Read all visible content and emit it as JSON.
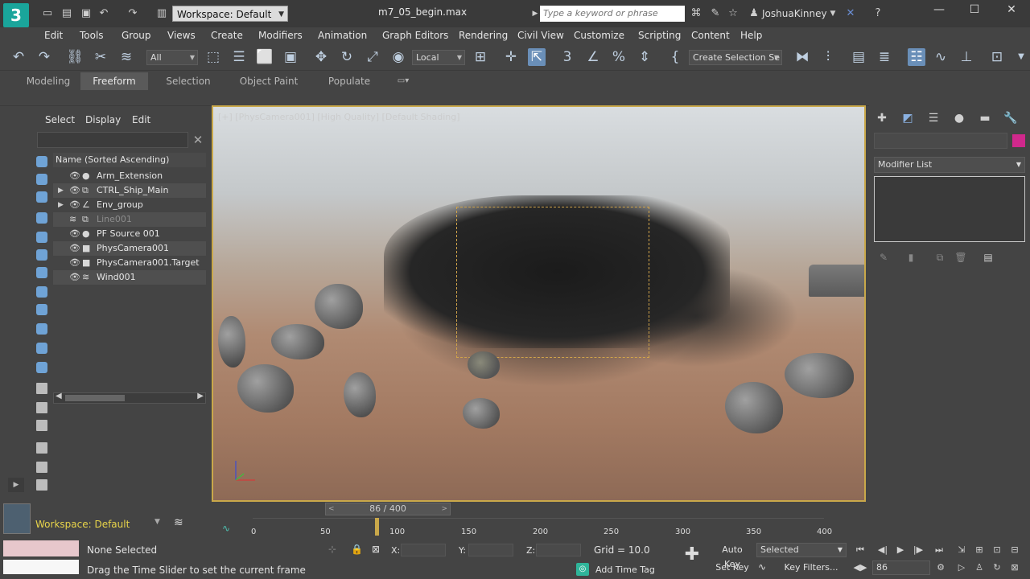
{
  "app": {
    "workspace": "Workspace: Default",
    "filename": "m7_05_begin.max",
    "search_placeholder": "Type a keyword or phrase",
    "username": "JoshuaKinney"
  },
  "menu": [
    "Edit",
    "Tools",
    "Group",
    "Views",
    "Create",
    "Modifiers",
    "Animation",
    "Graph Editors",
    "Rendering",
    "Civil View",
    "Customize",
    "Scripting",
    "Content",
    "Help"
  ],
  "toolbar": {
    "filter": "All",
    "coord_system": "Local",
    "selection_set": "Create Selection Se"
  },
  "ribbon_tabs": [
    "Modeling",
    "Freeform",
    "Selection",
    "Object Paint",
    "Populate"
  ],
  "explorer": {
    "menus": [
      "Select",
      "Display",
      "Edit"
    ],
    "column_header": "Name (Sorted Ascending)",
    "items": [
      {
        "name": "Arm_Extension"
      },
      {
        "name": "CTRL_Ship_Main"
      },
      {
        "name": "Env_group"
      },
      {
        "name": "Line001"
      },
      {
        "name": "PF Source 001"
      },
      {
        "name": "PhysCamera001"
      },
      {
        "name": "PhysCamera001.Target"
      },
      {
        "name": "Wind001"
      }
    ],
    "workspace_label": "Workspace: Default"
  },
  "viewport": {
    "label": "[+] [PhysCamera001] [High Quality] [Default Shading]"
  },
  "command_panel": {
    "modifier_list": "Modifier List",
    "color": "#d0288c"
  },
  "timeline": {
    "slider": "86 / 400",
    "ticks": [
      "0",
      "50",
      "100",
      "150",
      "200",
      "250",
      "300",
      "350",
      "400"
    ]
  },
  "status": {
    "selection": "None Selected",
    "prompt": "Drag the Time Slider to set the current frame",
    "x_label": "X:",
    "y_label": "Y:",
    "z_label": "Z:",
    "grid": "Grid = 10.0",
    "add_time_tag": "Add Time Tag",
    "auto_key": "Auto Key",
    "set_key": "Set Key",
    "key_mode": "Selected",
    "key_filters": "Key Filters...",
    "frame": "86"
  }
}
